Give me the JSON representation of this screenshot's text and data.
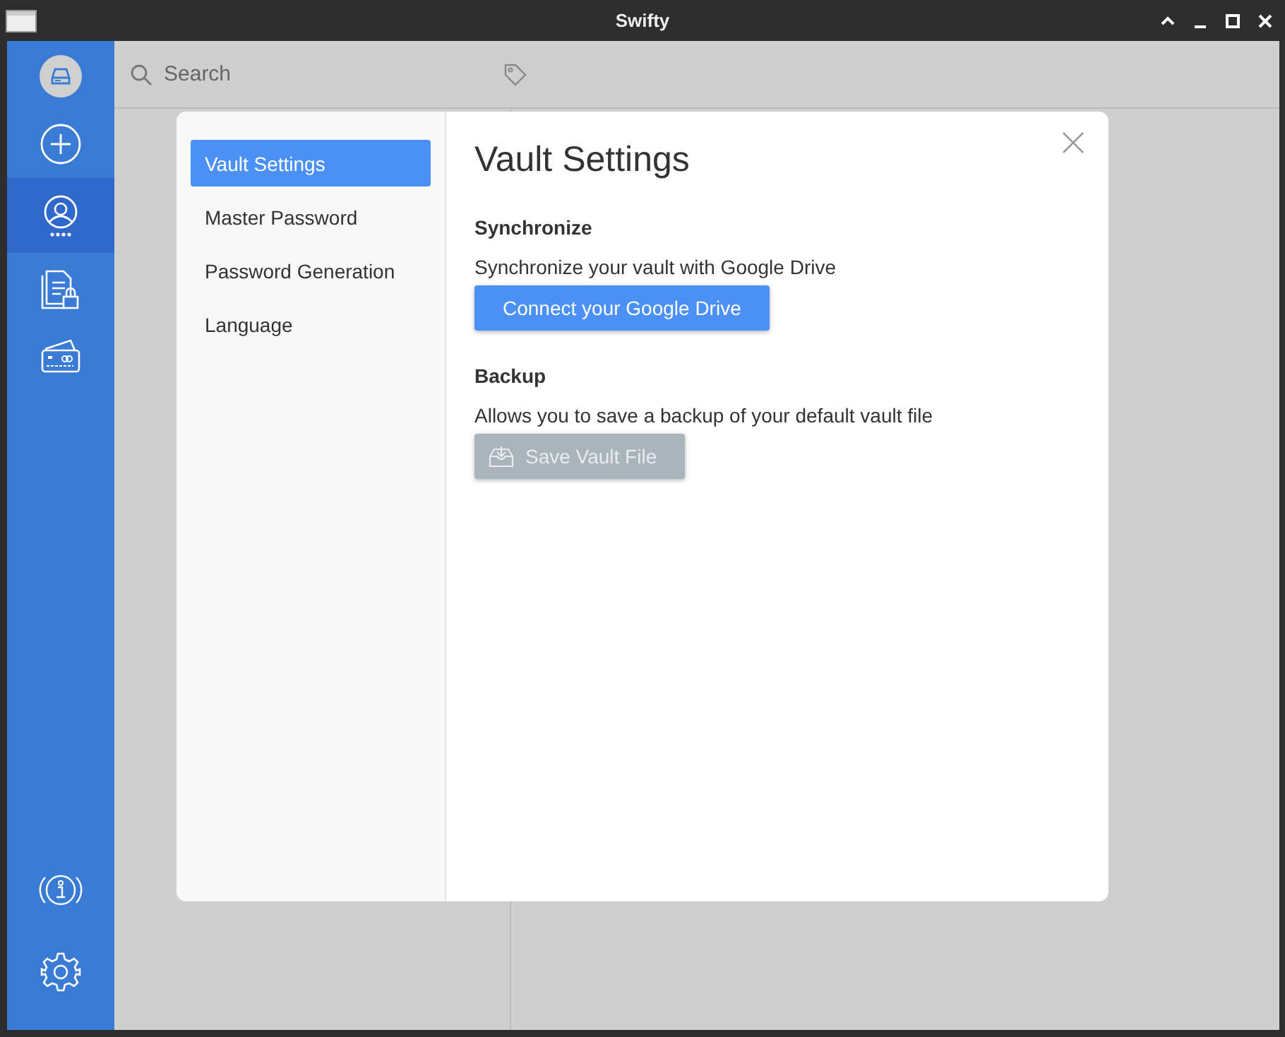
{
  "window": {
    "title": "Swifty"
  },
  "sidebar": {
    "top_items": [
      {
        "kind": "vault",
        "selected": false
      },
      {
        "kind": "add",
        "selected": false
      },
      {
        "kind": "accounts",
        "selected": true
      },
      {
        "kind": "notes",
        "selected": false
      },
      {
        "kind": "cards",
        "selected": false
      }
    ],
    "bottom_items": [
      {
        "kind": "info",
        "selected": false
      },
      {
        "kind": "settings",
        "selected": false
      }
    ]
  },
  "search": {
    "placeholder": "Search"
  },
  "dialog": {
    "nav": [
      {
        "label": "Vault Settings",
        "selected": true
      },
      {
        "label": "Master Password",
        "selected": false
      },
      {
        "label": "Password Generation",
        "selected": false
      },
      {
        "label": "Language",
        "selected": false
      }
    ],
    "title": "Vault Settings",
    "sections": [
      {
        "heading": "Synchronize",
        "description": "Synchronize your vault with Google Drive",
        "button": {
          "label": "Connect your Google Drive",
          "disabled": false,
          "kind": "plain"
        }
      },
      {
        "heading": "Backup",
        "description": "Allows you to save a backup of your default vault file",
        "button": {
          "label": "Save Vault File",
          "disabled": true,
          "kind": "download"
        }
      }
    ]
  }
}
